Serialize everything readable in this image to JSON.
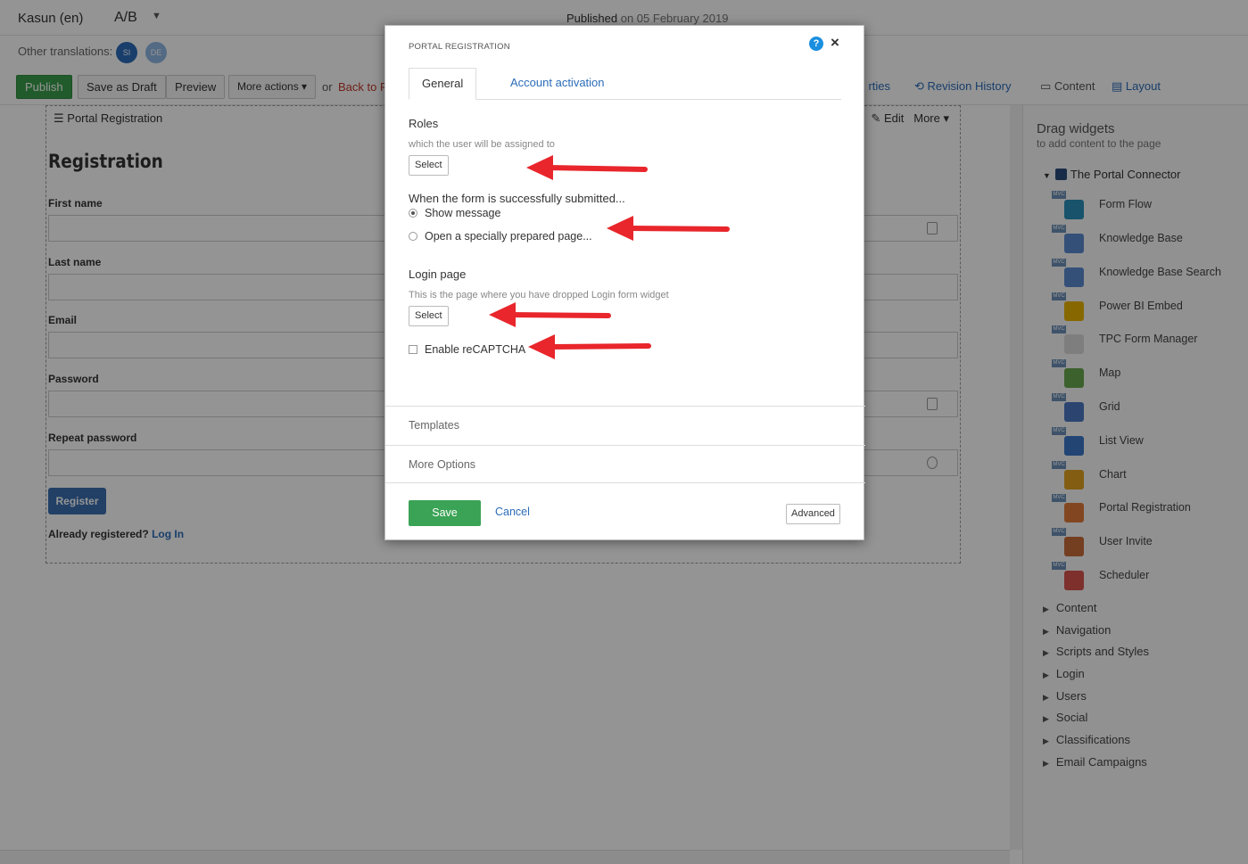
{
  "topbar": {
    "language": "Kasun (en)",
    "variant": "A/B",
    "published_label": "Published",
    "published_date": "on 05 February 2019"
  },
  "translations": {
    "label": "Other translations:",
    "langs": [
      "SI",
      "DE"
    ]
  },
  "toolbar": {
    "publish": "Publish",
    "save_draft": "Save as Draft",
    "preview": "Preview",
    "more_actions": "More actions",
    "or": "or",
    "back": "Back to P",
    "properties": "rties",
    "revision_history": "Revision History",
    "content_tab": "Content",
    "layout_tab": "Layout"
  },
  "page": {
    "widget_title": "Portal Registration",
    "edit": "Edit",
    "more": "More",
    "heading": "Registration",
    "fields": [
      "First name",
      "Last name",
      "Email",
      "Password",
      "Repeat password"
    ],
    "register_button": "Register",
    "already_text": "Already registered?",
    "login_link": "Log In"
  },
  "sidebar": {
    "title": "Drag widgets",
    "subtitle": "to add content to the page",
    "group": "The Portal Connector",
    "mvc_tag": "MVC",
    "widgets": [
      {
        "label": "Form Flow",
        "color": "#2a8fb8"
      },
      {
        "label": "Knowledge Base",
        "color": "#5b8bd0"
      },
      {
        "label": "Knowledge Base Search",
        "color": "#5b8bd0"
      },
      {
        "label": "Power BI Embed",
        "color": "#e8b400"
      },
      {
        "label": "TPC Form Manager",
        "color": "#d9d9d9"
      },
      {
        "label": "Map",
        "color": "#6aa84f"
      },
      {
        "label": "Grid",
        "color": "#4a78c2"
      },
      {
        "label": "List View",
        "color": "#3b78c9"
      },
      {
        "label": "Chart",
        "color": "#e0a020"
      },
      {
        "label": "Portal Registration",
        "color": "#e07b39"
      },
      {
        "label": "User Invite",
        "color": "#c86b3a"
      },
      {
        "label": "Scheduler",
        "color": "#d9534f"
      }
    ],
    "categories": [
      "Content",
      "Navigation",
      "Scripts and Styles",
      "Login",
      "Users",
      "Social",
      "Classifications",
      "Email Campaigns"
    ]
  },
  "dialog": {
    "title": "PORTAL REGISTRATION",
    "help": "?",
    "close": "×",
    "tabs": [
      "General",
      "Account activation"
    ],
    "roles_heading": "Roles",
    "roles_sub": "which the user will be assigned to",
    "select": "Select",
    "submit_heading": "When the form is successfully submitted...",
    "radio_show": "Show message",
    "radio_open": "Open a specially prepared page...",
    "login_heading": "Login page",
    "login_sub": "This is the page where you have dropped Login form widget",
    "recaptcha": "Enable reCAPTCHA",
    "templates": "Templates",
    "more_options": "More Options",
    "save": "Save",
    "cancel": "Cancel",
    "advanced": "Advanced"
  },
  "colors": {
    "accent_blue": "#2b6cb8",
    "publish_green": "#3a9d4a",
    "save_green": "#3aa355",
    "annotation_red": "#e8262b"
  }
}
